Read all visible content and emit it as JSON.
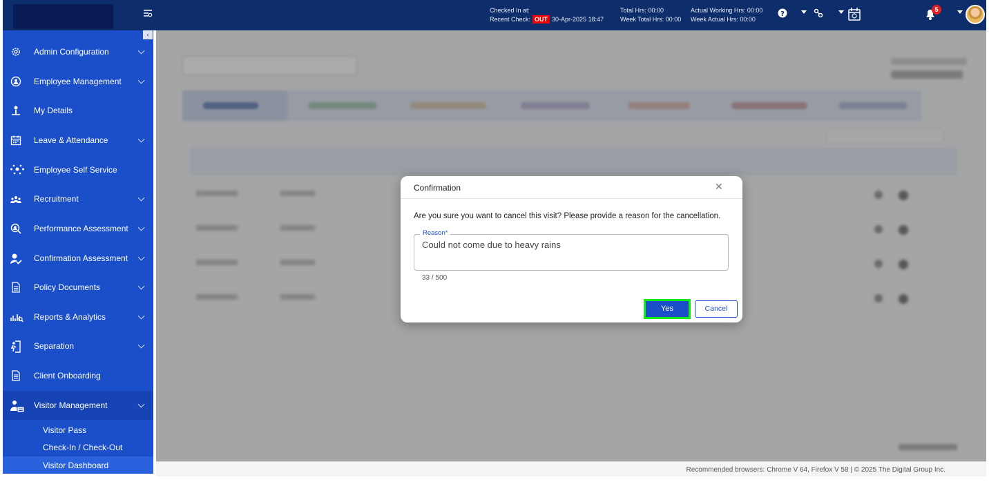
{
  "topbar": {
    "checked_in_label": "Checked In at:",
    "checked_in_value": "",
    "recent_check_label": "Recent Check:",
    "recent_check_status": "OUT",
    "recent_check_time": "30-Apr-2025 18:47",
    "total_hrs": "Total Hrs: 00:00",
    "week_total_hrs": "Week Total Hrs: 00:00",
    "actual_working_hrs": "Actual Working Hrs: 00:00",
    "week_actual_hrs": "Week Actual Hrs: 00:00",
    "notification_count": "5",
    "icons": [
      "menu-toggle-icon",
      "help-icon",
      "link-icon",
      "calendar-icon",
      "bell-icon"
    ]
  },
  "sidebar": {
    "items": [
      {
        "label": "Admin Configuration",
        "icon": "gear-icon",
        "expandable": true
      },
      {
        "label": "Employee Management",
        "icon": "employee-icon",
        "expandable": true
      },
      {
        "label": "My Details",
        "icon": "user-icon",
        "expandable": false
      },
      {
        "label": "Leave & Attendance",
        "icon": "calendar-icon",
        "expandable": true
      },
      {
        "label": "Employee Self Service",
        "icon": "network-icon",
        "expandable": false
      },
      {
        "label": "Recruitment",
        "icon": "group-icon",
        "expandable": true
      },
      {
        "label": "Performance Assessment",
        "icon": "performance-icon",
        "expandable": true
      },
      {
        "label": "Confirmation Assessment",
        "icon": "user-check-icon",
        "expandable": true
      },
      {
        "label": "Policy Documents",
        "icon": "document-icon",
        "expandable": true
      },
      {
        "label": "Reports & Analytics",
        "icon": "chart-icon",
        "expandable": true
      },
      {
        "label": "Separation",
        "icon": "exit-icon",
        "expandable": true
      },
      {
        "label": "Client Onboarding",
        "icon": "document-icon",
        "expandable": false
      },
      {
        "label": "Visitor Management",
        "icon": "visitor-icon",
        "expandable": true
      }
    ],
    "sub_items": [
      {
        "label": "Visitor Pass"
      },
      {
        "label": "Check-In / Check-Out"
      },
      {
        "label": "Visitor Dashboard",
        "selected": true
      }
    ]
  },
  "dialog": {
    "title": "Confirmation",
    "message": "Are you sure you want to cancel this visit? Please provide a reason for the cancellation.",
    "reason_label": "Reason*",
    "reason_value": "Could not come due to heavy rains",
    "counter": "33 / 500",
    "yes_label": "Yes",
    "cancel_label": "Cancel"
  },
  "footer": {
    "text": "Recommended browsers: Chrome V 64, Firefox V 58  |  © 2025 The Digital Group Inc."
  }
}
